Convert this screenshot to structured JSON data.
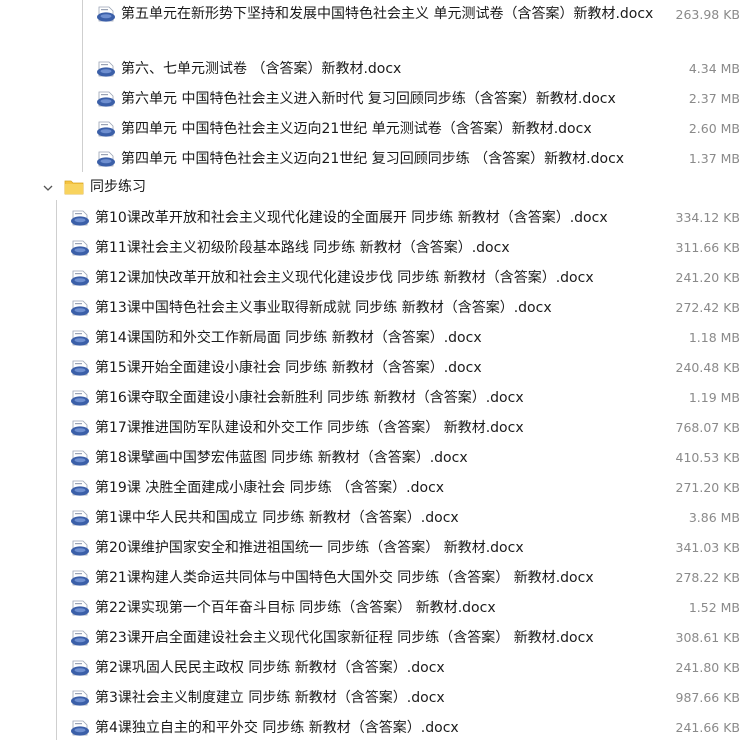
{
  "nested_files": [
    {
      "name": "第五单元在新形势下坚持和发展中国特色社会主义 单元测试卷（含答案）新教材.docx",
      "size": "263.98 KB"
    },
    {
      "name": "第六、七单元测试卷 （含答案）新教材.docx",
      "size": "4.34 MB"
    },
    {
      "name": "第六单元 中国特色社会主义进入新时代 复习回顾同步练（含答案）新教材.docx",
      "size": "2.37 MB"
    },
    {
      "name": "第四单元 中国特色社会主义迈向21世纪 单元测试卷（含答案）新教材.docx",
      "size": "2.60 MB"
    },
    {
      "name": "第四单元 中国特色社会主义迈向21世纪 复习回顾同步练 （含答案）新教材.docx",
      "size": "1.37 MB"
    }
  ],
  "folder": {
    "name": "同步练习",
    "icon": "folder-icon",
    "expanded": true
  },
  "folder_files": [
    {
      "name": "第10课改革开放和社会主义现代化建设的全面展开 同步练 新教材（含答案）.docx",
      "size": "334.12 KB"
    },
    {
      "name": "第11课社会主义初级阶段基本路线 同步练 新教材（含答案）.docx",
      "size": "311.66 KB"
    },
    {
      "name": "第12课加快改革开放和社会主义现代化建设步伐 同步练 新教材（含答案）.docx",
      "size": "241.20 KB"
    },
    {
      "name": "第13课中国特色社会主义事业取得新成就 同步练 新教材（含答案）.docx",
      "size": "272.42 KB"
    },
    {
      "name": "第14课国防和外交工作新局面 同步练 新教材（含答案）.docx",
      "size": "1.18 MB"
    },
    {
      "name": "第15课开始全面建设小康社会 同步练 新教材（含答案）.docx",
      "size": "240.48 KB"
    },
    {
      "name": "第16课夺取全面建设小康社会新胜利 同步练 新教材（含答案）.docx",
      "size": "1.19 MB"
    },
    {
      "name": "第17课推进国防军队建设和外交工作 同步练（含答案） 新教材.docx",
      "size": "768.07 KB"
    },
    {
      "name": "第18课擘画中国梦宏伟蓝图 同步练 新教材（含答案）.docx",
      "size": "410.53 KB"
    },
    {
      "name": "第19课 决胜全面建成小康社会 同步练 （含答案）.docx",
      "size": "271.20 KB"
    },
    {
      "name": "第1课中华人民共和国成立 同步练 新教材（含答案）.docx",
      "size": "3.86 MB"
    },
    {
      "name": "第20课维护国家安全和推进祖国统一 同步练（含答案） 新教材.docx",
      "size": "341.03 KB"
    },
    {
      "name": "第21课构建人类命运共同体与中国特色大国外交 同步练（含答案） 新教材.docx",
      "size": "278.22 KB"
    },
    {
      "name": "第22课实现第一个百年奋斗目标 同步练（含答案） 新教材.docx",
      "size": "1.52 MB"
    },
    {
      "name": "第23课开启全面建设社会主义现代化国家新征程 同步练（含答案） 新教材.docx",
      "size": "308.61 KB"
    },
    {
      "name": "第2课巩固人民民主政权 同步练 新教材（含答案）.docx",
      "size": "241.80 KB"
    },
    {
      "name": "第3课社会主义制度建立 同步练 新教材（含答案）.docx",
      "size": "987.66 KB"
    },
    {
      "name": "第4课独立自主的和平外交 同步练 新教材（含答案）.docx",
      "size": "241.66 KB"
    }
  ],
  "colors": {
    "doc_icon": "#3b5fa8",
    "folder": "#f5c342",
    "tree_line": "#cfcfcf"
  }
}
